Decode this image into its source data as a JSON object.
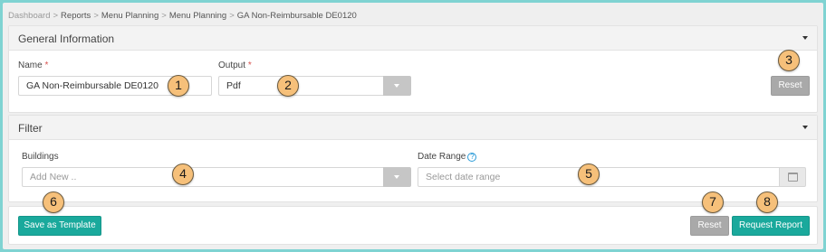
{
  "breadcrumb": [
    "Dashboard",
    "Reports",
    "Menu Planning",
    "Menu Planning",
    "GA Non-Reimbursable DE0120"
  ],
  "breadcrumb_sep": ">",
  "general": {
    "title": "General Information",
    "name_label": "Name",
    "name_value": "GA Non-Reimbursable DE0120",
    "output_label": "Output",
    "output_value": "Pdf",
    "required_mark": "*",
    "reset_label": "Reset"
  },
  "filter": {
    "title": "Filter",
    "buildings_label": "Buildings",
    "buildings_placeholder": "Add New ..",
    "date_range_label": "Date Range",
    "date_range_placeholder": "Select date range",
    "help_glyph": "?"
  },
  "footer": {
    "save_template_label": "Save as Template",
    "reset_label": "Reset",
    "request_report_label": "Request Report"
  },
  "callouts": [
    "1",
    "2",
    "3",
    "4",
    "5",
    "6",
    "7",
    "8"
  ],
  "colors": {
    "page_border": "#7fd3d2",
    "teal_button": "#1aa99c",
    "gray_button": "#a9a9a9",
    "callout_fill": "#f6c07a",
    "required": "#d9534f"
  }
}
